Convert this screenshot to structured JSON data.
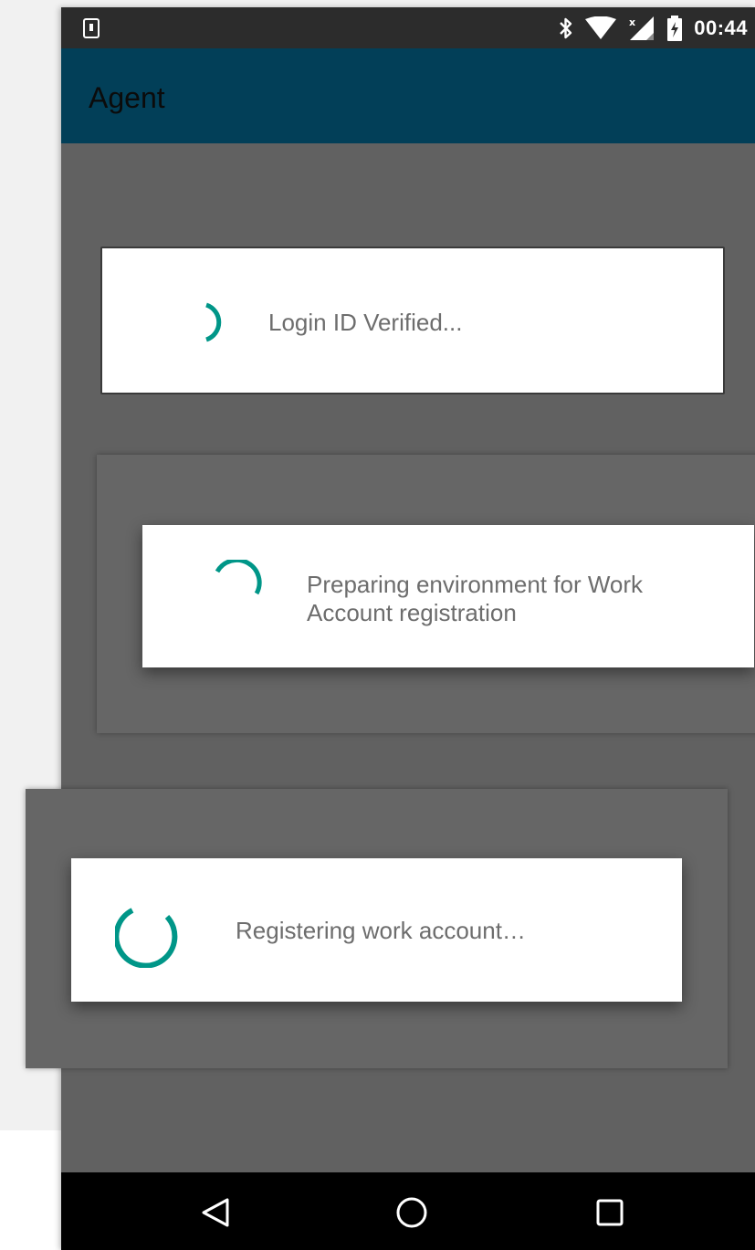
{
  "status_bar": {
    "time": "00:44",
    "icons": [
      "download-notification-icon",
      "bluetooth-icon",
      "wifi-icon",
      "signal-no-data-icon",
      "battery-charging-icon"
    ]
  },
  "app_bar": {
    "title": "Agent",
    "color": "#023f58"
  },
  "dialogs": [
    {
      "message": "Login ID Verified..."
    },
    {
      "message": "Preparing environment for Work Account registration"
    },
    {
      "message": "Registering work account…"
    }
  ],
  "spinner_color": "#009688",
  "nav_bar": {
    "buttons": [
      "back-icon",
      "home-icon",
      "recents-icon"
    ]
  }
}
